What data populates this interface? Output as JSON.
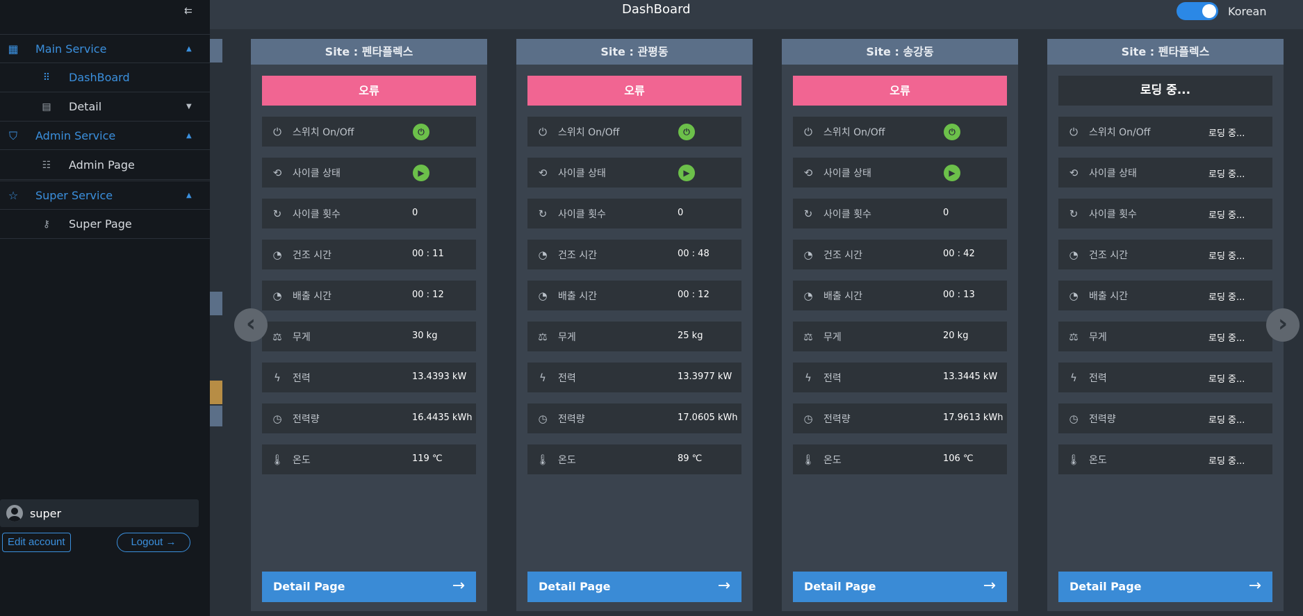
{
  "header": {
    "title": "DashBoard",
    "language_label": "Korean",
    "language_toggle_on": true
  },
  "sidebar": {
    "collapse_icon": "collapse-left-icon",
    "sections": [
      {
        "label": "Main Service",
        "icon": "grid-icon",
        "items": [
          {
            "label": "DashBoard",
            "icon": "dots-grid-icon",
            "active": true
          },
          {
            "label": "Detail",
            "icon": "document-icon",
            "has_dropdown": true
          }
        ]
      },
      {
        "label": "Admin Service",
        "icon": "shield-icon",
        "items": [
          {
            "label": "Admin Page",
            "icon": "sliders-icon"
          }
        ]
      },
      {
        "label": "Super Service",
        "icon": "star-icon",
        "items": [
          {
            "label": "Super Page",
            "icon": "key-icon"
          }
        ]
      }
    ],
    "user": {
      "name": "super",
      "edit_label": "Edit account",
      "logout_label": "Logout"
    }
  },
  "row_labels": {
    "switch": "스위치 On/Off",
    "cycle_status": "사이클 상태",
    "cycle_count": "사이클 횟수",
    "dry_time": "건조 시간",
    "discharge_time": "배출 시간",
    "weight": "무게",
    "power": "전력",
    "energy": "전력량",
    "temperature": "온도"
  },
  "cards": [
    {
      "site": "Site : 펜타플렉스",
      "status": "오류",
      "cycle_count": "0",
      "dry_time": "00 : 11",
      "discharge_time": "00 : 12",
      "weight": "30 kg",
      "power": "13.4393 kW",
      "energy": "16.4435 kWh",
      "temperature": "119 ℃",
      "detail_label": "Detail Page"
    },
    {
      "site": "Site : 관평동",
      "status": "오류",
      "cycle_count": "0",
      "dry_time": "00 : 48",
      "discharge_time": "00 : 12",
      "weight": "25 kg",
      "power": "13.3977 kW",
      "energy": "17.0605 kWh",
      "temperature": "89 ℃",
      "detail_label": "Detail Page"
    },
    {
      "site": "Site : 송강동",
      "status": "오류",
      "cycle_count": "0",
      "dry_time": "00 : 42",
      "discharge_time": "00 : 13",
      "weight": "20 kg",
      "power": "13.3445 kW",
      "energy": "17.9613 kWh",
      "temperature": "106 ℃",
      "detail_label": "Detail Page"
    },
    {
      "site": "Site : 펜타플렉스",
      "status": "로딩 중...",
      "switch": "로딩 중...",
      "cycle_status": "로딩 중...",
      "cycle_count": "로딩 중...",
      "dry_time": "로딩 중...",
      "discharge_time": "로딩 중...",
      "weight": "로딩 중...",
      "power": "로딩 중...",
      "energy": "로딩 중...",
      "temperature": "로딩 중...",
      "detail_label": "Detail Page"
    }
  ],
  "colors": {
    "accent": "#3b90de",
    "error": "#f16592",
    "status_ok": "#6cc04a",
    "card_header": "#5b6f88"
  }
}
